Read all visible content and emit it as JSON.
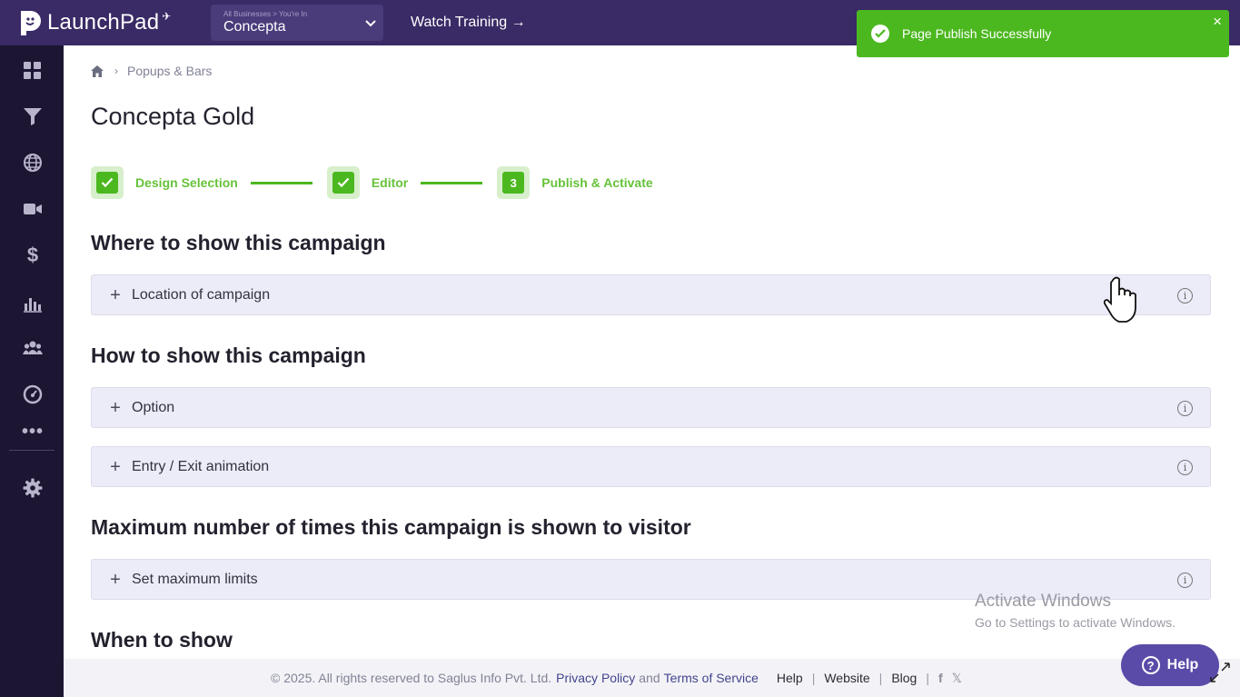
{
  "topbar": {
    "brand": "LaunchPad",
    "business_hint": "All Businesses > You're In",
    "business_name": "Concepta",
    "watch_training": "Watch Training →"
  },
  "sidebar": {
    "icons": [
      "dashboard-icon",
      "funnel-icon",
      "globe-icon",
      "video-icon",
      "dollar-icon",
      "analytics-icon",
      "users-icon",
      "gauge-icon",
      "more-icon",
      "settings-icon"
    ]
  },
  "breadcrumb": {
    "current": "Popups & Bars"
  },
  "page": {
    "title": "Concepta Gold"
  },
  "steps": [
    {
      "label": "Design Selection",
      "state": "done"
    },
    {
      "label": "Editor",
      "state": "done"
    },
    {
      "number": "3",
      "label": "Publish & Activate",
      "state": "current"
    }
  ],
  "sections": {
    "where": "Where to show this campaign",
    "how": "How to show this campaign",
    "max": "Maximum number of times this campaign is shown to visitor",
    "when": "When to show"
  },
  "accordions": {
    "location": "Location of campaign",
    "option": "Option",
    "animation": "Entry / Exit animation",
    "limits": "Set maximum limits"
  },
  "toast": {
    "message": "Page Publish Successfully",
    "close": "×"
  },
  "footer": {
    "copyright": "©  2025. All rights reserved to Saglus Info Pvt. Ltd.",
    "privacy": "Privacy Policy",
    "and": "and",
    "terms": "Terms of Service",
    "help": "Help",
    "website": "Website",
    "blog": "Blog"
  },
  "help_button": {
    "label": "Help"
  },
  "watermark": {
    "title": "Activate Windows",
    "subtitle": "Go to Settings to activate Windows."
  },
  "colors": {
    "topbar": "#3a2a66",
    "sidebar": "#1d1633",
    "success": "#4cb820",
    "accordion": "#ececf9",
    "link": "#43448f",
    "help_button": "#5a4ba8"
  }
}
